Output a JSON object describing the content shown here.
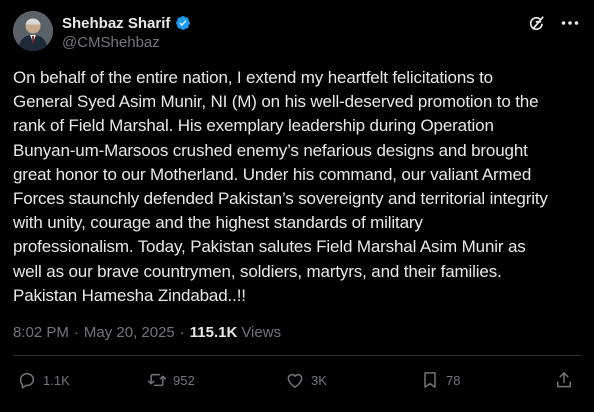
{
  "author": {
    "display_name": "Shehbaz Sharif",
    "handle": "@CMShehbaz"
  },
  "icons": {
    "verified": "verified-badge-icon",
    "grok": "grok-icon",
    "more": "more-icon"
  },
  "post": {
    "text": "On behalf of the entire nation, I extend my heartfelt felicitations to\nGeneral Syed Asim Munir, NI (M) on his well-deserved promotion to the\nrank of Field Marshal. His exemplary leadership during Operation\nBunyan-um-Marsoos crushed enemy’s nefarious designs and brought\ngreat honor to our Motherland. Under his command, our valiant Armed\nForces staunchly defended Pakistan’s sovereignty and territorial integrity\nwith unity, courage and the highest standards of military\nprofessionalism. Today, Pakistan salutes Field Marshal Asim Munir as\nwell as our brave countrymen, soldiers, martyrs, and their families.\nPakistan Hamesha Zindabad..!!",
    "time": "8:02 PM",
    "date": "May 20, 2025",
    "views_count": "115.1K",
    "views_label": "Views"
  },
  "actions": {
    "replies": "1.1K",
    "reposts": "952",
    "likes": "3K",
    "bookmarks": "78"
  },
  "colors": {
    "background": "#000000",
    "text": "#e7e9ea",
    "secondary": "#71767b",
    "verified": "#1d9bf0",
    "divider": "#2f3336"
  }
}
